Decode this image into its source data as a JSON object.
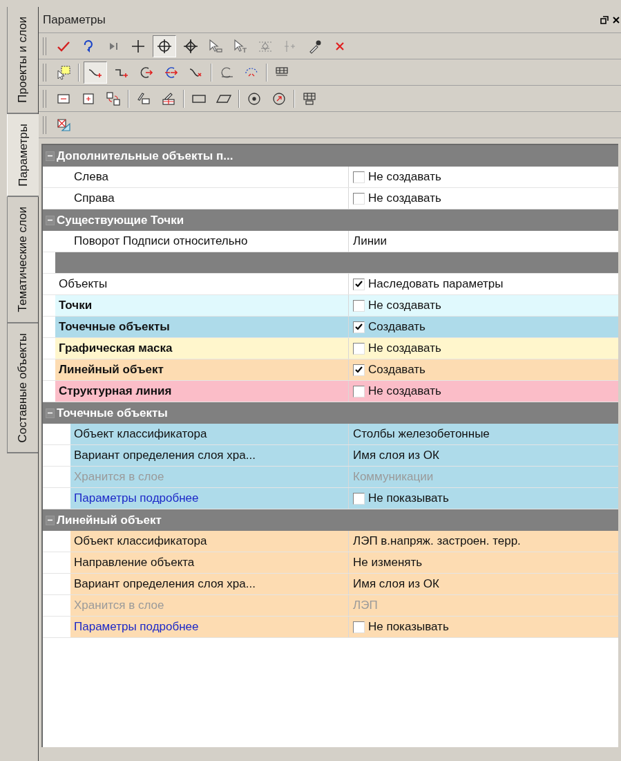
{
  "side_tabs": [
    {
      "label": "Проекты и слои",
      "selected": false
    },
    {
      "label": "Параметры",
      "selected": true
    },
    {
      "label": "Тематические слои",
      "selected": false
    },
    {
      "label": "Составные объекты",
      "selected": false
    }
  ],
  "panel": {
    "title": "Параметры"
  },
  "toolbars": [
    {
      "buttons": [
        {
          "pressed": false
        },
        {
          "pressed": false
        },
        {
          "pressed": false
        },
        {
          "pressed": false
        },
        {
          "pressed": true
        },
        {
          "pressed": false
        },
        {
          "pressed": false
        },
        {
          "pressed": false
        },
        {
          "pressed": false
        },
        {
          "pressed": false
        },
        {
          "pressed": false
        },
        {
          "pressed": false
        }
      ]
    },
    {
      "buttons": [
        {
          "pressed": false
        },
        {
          "pressed": true
        },
        {
          "pressed": false
        },
        {
          "pressed": false
        },
        {
          "pressed": false
        },
        {
          "pressed": false
        },
        {
          "pressed": false
        },
        {
          "pressed": false
        },
        {
          "pressed": false
        }
      ]
    },
    {
      "buttons": [
        {
          "pressed": false
        },
        {
          "pressed": false
        },
        {
          "pressed": false
        },
        {
          "pressed": false
        },
        {
          "pressed": false
        },
        {
          "pressed": false
        },
        {
          "pressed": false
        },
        {
          "pressed": false
        },
        {
          "pressed": false
        },
        {
          "pressed": false
        }
      ]
    },
    {
      "buttons": [
        {
          "pressed": false
        }
      ]
    }
  ],
  "rows": [
    {
      "kind": "group",
      "label": "Дополнительные объекты п...",
      "expanded": true,
      "children": [
        {
          "kind": "property",
          "label": "Слева",
          "color": "#ffffff",
          "value": {
            "kind": "checkbox",
            "label": "Не создавать",
            "checked": false
          }
        },
        {
          "kind": "property",
          "label": "Справа",
          "color": "#ffffff",
          "value": {
            "kind": "checkbox",
            "label": "Не создавать",
            "checked": false
          }
        }
      ]
    },
    {
      "kind": "group",
      "label": "Существующие Точки",
      "expanded": true,
      "children": [
        {
          "kind": "property",
          "label": "Поворот Подписи относительно",
          "color": "#ffffff",
          "value": {
            "kind": "text",
            "text": "Линии"
          }
        }
      ]
    },
    {
      "kind": "separator"
    },
    {
      "kind": "property",
      "label": "Объекты",
      "color": "#ffffff",
      "value": {
        "kind": "checkbox",
        "label": "Наследовать параметры",
        "checked": true
      }
    },
    {
      "kind": "property",
      "label": "Точки",
      "bold": true,
      "color": "#e0f9fd",
      "value": {
        "kind": "checkbox",
        "label": "Не создавать",
        "checked": false
      }
    },
    {
      "kind": "property",
      "label": "Точечные объекты",
      "bold": true,
      "color": "#aedbea",
      "value": {
        "kind": "checkbox",
        "label": "Создавать",
        "checked": true
      }
    },
    {
      "kind": "property",
      "label": "Графическая маска",
      "bold": true,
      "color": "#fff6cc",
      "value": {
        "kind": "checkbox",
        "label": "Не создавать",
        "checked": false
      }
    },
    {
      "kind": "property",
      "label": "Линейный объект",
      "bold": true,
      "color": "#fddcb2",
      "value": {
        "kind": "checkbox",
        "label": "Создавать",
        "checked": true
      }
    },
    {
      "kind": "property",
      "label": "Структурная линия",
      "bold": true,
      "color": "#fbbdc8",
      "value": {
        "kind": "checkbox",
        "label": "Не создавать",
        "checked": false
      }
    },
    {
      "kind": "group",
      "label": "Точечные объекты",
      "expanded": true,
      "children": [
        {
          "kind": "property",
          "label": "Объект классификатора",
          "color": "#aedbea",
          "value": {
            "kind": "text",
            "text": "Столбы железобетонные"
          }
        },
        {
          "kind": "property",
          "label": "Вариант определения слоя хра...",
          "color": "#aedbea",
          "value": {
            "kind": "text",
            "text": "Имя слоя из ОК"
          }
        },
        {
          "kind": "property",
          "label": "Хранится в слое",
          "disabled": true,
          "color": "#aedbea",
          "value": {
            "kind": "text",
            "text": "Коммуникации"
          }
        },
        {
          "kind": "property",
          "label": "Параметры подробнее",
          "link": true,
          "color": "#aedbea",
          "value": {
            "kind": "checkbox",
            "label": "Не показывать",
            "checked": false
          }
        }
      ]
    },
    {
      "kind": "group",
      "label": "Линейный объект",
      "expanded": true,
      "children": [
        {
          "kind": "property",
          "label": "Объект классификатора",
          "color": "#fddcb2",
          "value": {
            "kind": "text",
            "text": "ЛЭП в.напряж. застроен. терр."
          }
        },
        {
          "kind": "property",
          "label": "Направление объекта",
          "color": "#fddcb2",
          "value": {
            "kind": "text",
            "text": "Не изменять"
          }
        },
        {
          "kind": "property",
          "label": "Вариант определения слоя хра...",
          "color": "#fddcb2",
          "value": {
            "kind": "text",
            "text": "Имя слоя из ОК"
          }
        },
        {
          "kind": "property",
          "label": "Хранится в слое",
          "disabled": true,
          "color": "#fddcb2",
          "value": {
            "kind": "text",
            "text": "ЛЭП"
          }
        },
        {
          "kind": "property",
          "label": "Параметры подробнее",
          "link": true,
          "color": "#fddcb2",
          "value": {
            "kind": "checkbox",
            "label": "Не показывать",
            "checked": false
          }
        }
      ]
    }
  ]
}
